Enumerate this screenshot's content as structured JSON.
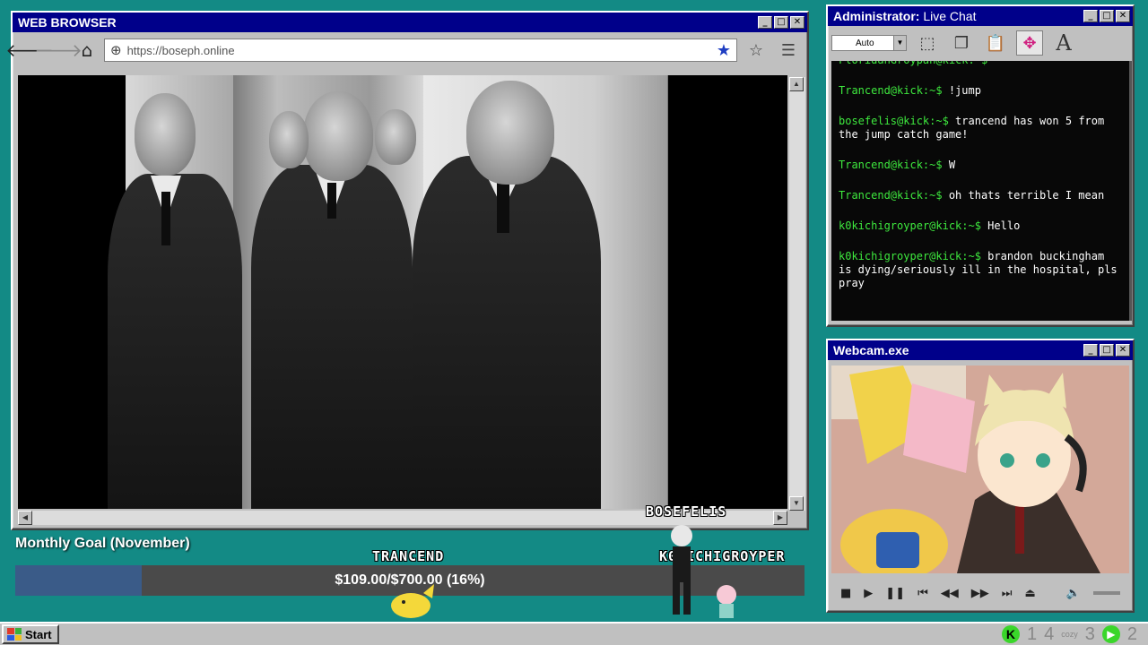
{
  "browser": {
    "title": "WEB BROWSER",
    "url": "https://boseph.online"
  },
  "goal": {
    "title": "Monthly Goal (November)",
    "progress_text": "$109.00/$700.00 (16%)",
    "progress_fraction": 0.16,
    "fill_color": "#3a5b88"
  },
  "overlay_names": [
    "TRANCEND",
    "BOSEFELIS",
    "K0KICHIGROYPER"
  ],
  "chat": {
    "title_bold": "Administrator:",
    "title_rest": " Live Chat",
    "font_select": "Auto",
    "messages": [
      {
        "user": "FloridanGroypan@kick:~$",
        "text": ""
      },
      {
        "user": "Trancend@kick:~$",
        "text": " !jump"
      },
      {
        "user": "bosefelis@kick:~$",
        "text": " trancend has won 5 from the jump catch game!"
      },
      {
        "user": "Trancend@kick:~$",
        "text": " W"
      },
      {
        "user": "Trancend@kick:~$",
        "text": " oh thats terrible I mean"
      },
      {
        "user": "k0kichigroyper@kick:~$",
        "text": " Hello"
      },
      {
        "user": "k0kichigroyper@kick:~$",
        "text": " brandon buckingham is dying/seriously ill in the hospital, pls pray"
      }
    ],
    "user_color": "#3ee83e"
  },
  "webcam": {
    "title": "Webcam.exe"
  },
  "taskbar": {
    "start_label": "Start",
    "tray_numbers": [
      "1",
      "4",
      "3",
      "2"
    ],
    "tray_small": "cozy"
  }
}
